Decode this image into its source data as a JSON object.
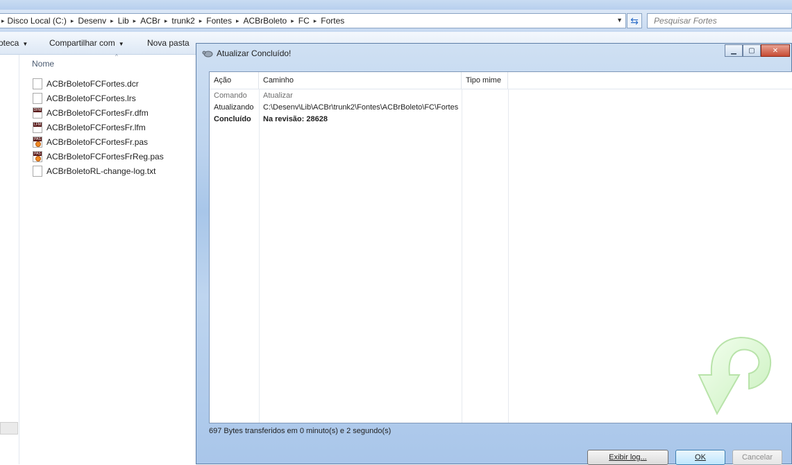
{
  "explorer": {
    "breadcrumb": [
      "Disco Local (C:)",
      "Desenv",
      "Lib",
      "ACBr",
      "trunk2",
      "Fontes",
      "ACBrBoleto",
      "FC",
      "Fortes"
    ],
    "search_placeholder": "Pesquisar Fortes",
    "toolbar": {
      "library_label": "oteca",
      "share_label": "Compartilhar com",
      "new_folder_label": "Nova pasta"
    },
    "column_name": "Nome",
    "files": [
      {
        "name": "ACBrBoletoFCFortes.dcr",
        "icon": "blank-doc-icon"
      },
      {
        "name": "ACBrBoletoFCFortes.lrs",
        "icon": "blank-doc-icon"
      },
      {
        "name": "ACBrBoletoFCFortesFr.dfm",
        "icon": "dfm-file-icon",
        "badge": "DFM"
      },
      {
        "name": "ACBrBoletoFCFortesFr.lfm",
        "icon": "lfm-file-icon",
        "badge": "LFM"
      },
      {
        "name": "ACBrBoletoFCFortesFr.pas",
        "icon": "pas-file-icon",
        "badge": "PAS"
      },
      {
        "name": "ACBrBoletoFCFortesFrReg.pas",
        "icon": "pas-file-icon",
        "badge": "PAS"
      },
      {
        "name": "ACBrBoletoRL-change-log.txt",
        "icon": "text-file-icon"
      }
    ]
  },
  "dialog": {
    "title": "Atualizar Concluído!",
    "columns": [
      "Ação",
      "Caminho",
      "Tipo mime"
    ],
    "rows": [
      {
        "action": "Comando",
        "path": "Atualizar",
        "style": "gray"
      },
      {
        "action": "Atualizando",
        "path": "C:\\Desenv\\Lib\\ACBr\\trunk2\\Fontes\\ACBrBoleto\\FC\\Fortes",
        "style": "normal"
      },
      {
        "action": "Concluído",
        "path": "Na revisão: 28628",
        "style": "bold"
      }
    ],
    "status": "697 Bytes transferidos em 0 minuto(s) e 2 segundo(s)",
    "buttons": {
      "log": "Exibir log...",
      "ok": "OK",
      "cancel": "Cancelar"
    },
    "update_icon": "green-curved-arrow-icon"
  }
}
